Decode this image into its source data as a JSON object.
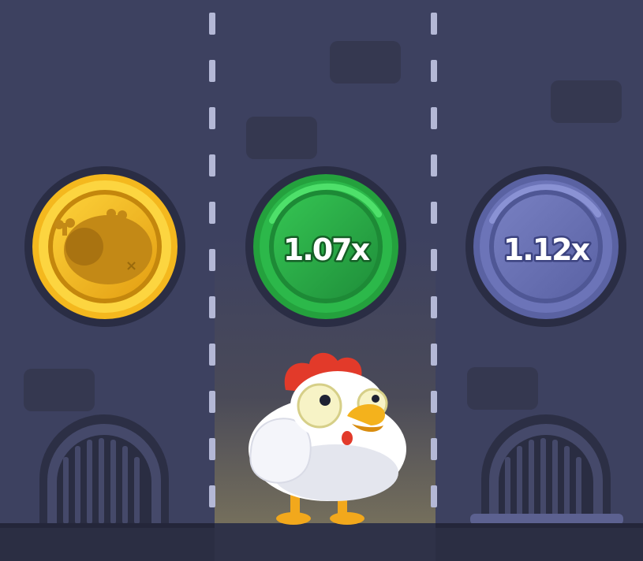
{
  "game": {
    "lanes": [
      {
        "id": "lane-1",
        "coin": {
          "type": "lost",
          "icon": "dead-chicken-icon",
          "color": "#f2b21e"
        },
        "drain": "sewer-grate"
      },
      {
        "id": "lane-2",
        "coin": {
          "type": "multiplier",
          "label": "1.07x",
          "color": "#2fb34a",
          "state": "active"
        },
        "player": "chicken-character"
      },
      {
        "id": "lane-3",
        "coin": {
          "type": "multiplier",
          "label": "1.12x",
          "color": "#6870b5",
          "state": "upcoming"
        },
        "drain": "sewer-grate"
      }
    ],
    "colors": {
      "background": "#3d4160",
      "active_lane": "#6d6757",
      "lane_divider": "#b8bcd8",
      "ground": "#2c2f44"
    }
  }
}
